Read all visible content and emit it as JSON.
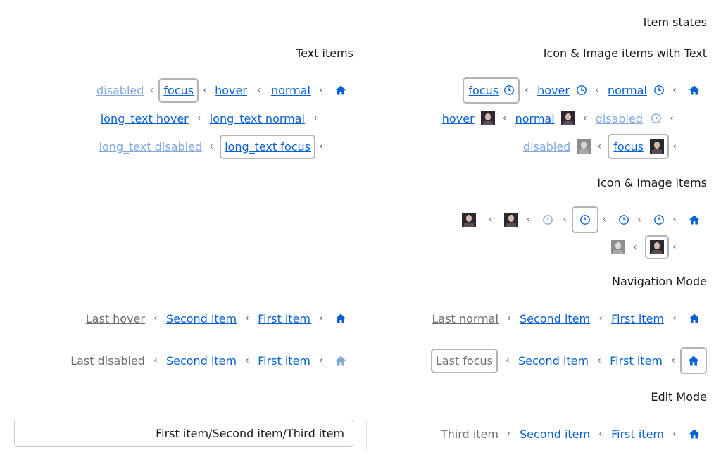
{
  "headings": {
    "item_states": "Item states",
    "text_items": "Text items",
    "icon_image_text": "Icon & Image items with Text",
    "icon_image": "Icon & Image items",
    "navigation_mode": "Navigation Mode",
    "edit_mode": "Edit Mode"
  },
  "text_items": {
    "disabled": "disabled",
    "focus": "focus",
    "hover": "hover",
    "normal": "normal",
    "long_hover": "long_text hover",
    "long_normal": "long_text normal",
    "long_disabled": "long_text disabled",
    "long_focus": "long_text focus"
  },
  "icon_text_items": {
    "focus": "focus",
    "hover": "hover",
    "normal": "normal",
    "img_hover": "hover",
    "img_normal": "normal",
    "icon_disabled": "disabled",
    "img_disabled": "disabled",
    "img_focus": "focus"
  },
  "navigation": {
    "last_hover": "Last hover",
    "last_normal": "Last normal",
    "last_disabled": "Last disabled",
    "last_focus": "Last focus",
    "second_item": "Second item",
    "first_item": "First item"
  },
  "edit_mode": {
    "path_value": "First item/Second item/Third item",
    "third_item": "Third item",
    "second_item": "Second item",
    "first_item": "First item"
  },
  "colors": {
    "link": "#0a62d0",
    "link_disabled": "#82a8dc",
    "gray_text": "#707070",
    "focus_border": "#b4b4b4"
  },
  "icons": {
    "home": "home-icon",
    "clock": "clock-icon",
    "separator": "chevron-left-icon",
    "image": "avatar-image"
  }
}
